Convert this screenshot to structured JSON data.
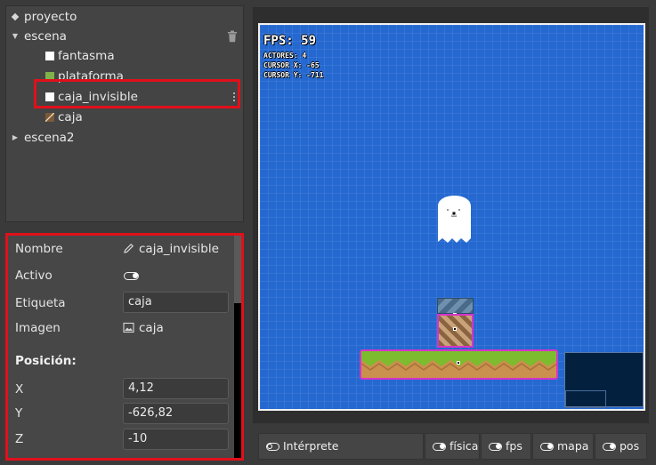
{
  "tree": {
    "project": "proyecto",
    "scene": "escena",
    "children": [
      "fantasma",
      "plataforma",
      "caja_invisible",
      "caja"
    ],
    "scene2": "escena2"
  },
  "properties": {
    "name_label": "Nombre",
    "name_value": "caja_invisible",
    "active_label": "Activo",
    "tag_label": "Etiqueta",
    "tag_value": "caja",
    "image_label": "Imagen",
    "image_value": "caja",
    "position_label": "Posición:",
    "x_label": "X",
    "x_value": "4,12",
    "y_label": "Y",
    "y_value": "-626,82",
    "z_label": "Z",
    "z_value": "-10"
  },
  "hud": {
    "fps": "FPS: 59",
    "actors": "ACTORES: 4",
    "cursor_x": "CURSOR X: -65",
    "cursor_y": "CURSOR Y: -711"
  },
  "toolbar": {
    "interpreter": "Intérprete",
    "physics": "física",
    "fps": "fps",
    "map": "mapa",
    "pos": "pos"
  },
  "colors": {
    "selection_outline": "#e0101a",
    "canvas_bg": "#2468d0",
    "actor_outline": "#d534c8"
  },
  "icons": [
    "diamond-icon",
    "caret-down-icon",
    "caret-right-icon",
    "trash-icon",
    "kebab-menu-icon",
    "pencil-icon",
    "image-icon",
    "toggle-icon"
  ]
}
